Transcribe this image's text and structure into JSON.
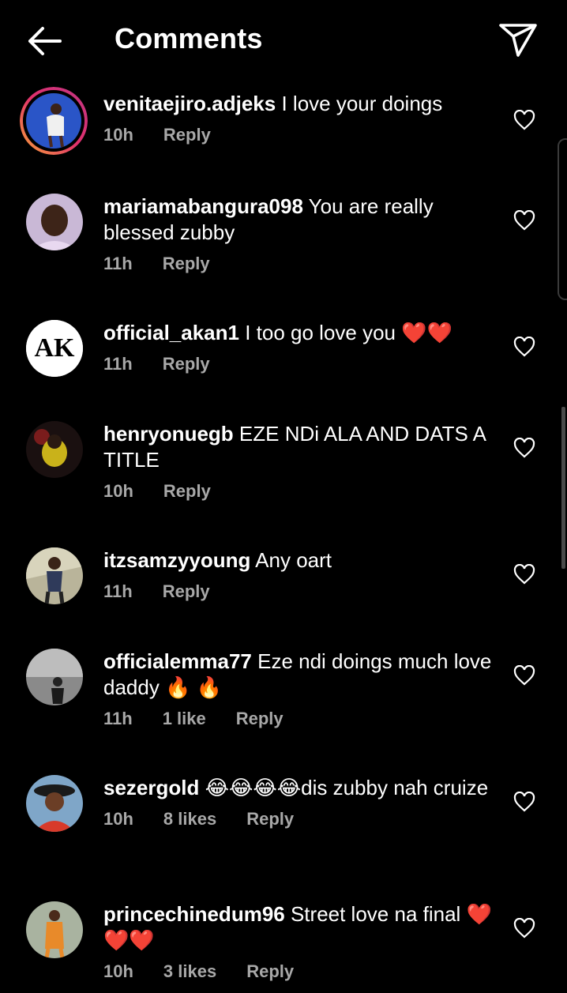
{
  "header": {
    "title": "Comments",
    "back_icon": "arrow-left-icon",
    "share_icon": "send-icon"
  },
  "comments": [
    {
      "user": "venitaejiro.adjeks",
      "text": "I love your doings",
      "time": "10h",
      "likes": "",
      "reply": "Reply"
    },
    {
      "user": "mariamabangura098",
      "text": "You are really blessed zubby",
      "time": "11h",
      "likes": "",
      "reply": "Reply"
    },
    {
      "user": "official_akan1",
      "text": "I too go love you ❤️❤️",
      "time": "11h",
      "likes": "",
      "reply": "Reply"
    },
    {
      "user": "henryonuegb",
      "text": "EZE NDi ALA AND DATS A TITLE",
      "time": "10h",
      "likes": "",
      "reply": "Reply"
    },
    {
      "user": "itzsamzyyoung",
      "text": "Any oart",
      "time": "11h",
      "likes": "",
      "reply": "Reply"
    },
    {
      "user": "officialemma77",
      "text": "Eze ndi doings much love daddy 🔥 🔥",
      "time": "11h",
      "likes": "1 like",
      "reply": "Reply"
    },
    {
      "user": "sezergold",
      "text": "😂😂😂😂dis zubby nah cruize",
      "time": "10h",
      "likes": "8 likes",
      "reply": "Reply"
    },
    {
      "user": "princechinedum96",
      "text": "Street love na final ❤️❤️❤️",
      "time": "10h",
      "likes": "3 likes",
      "reply": "Reply"
    }
  ],
  "avatar_logo_text": "AK"
}
